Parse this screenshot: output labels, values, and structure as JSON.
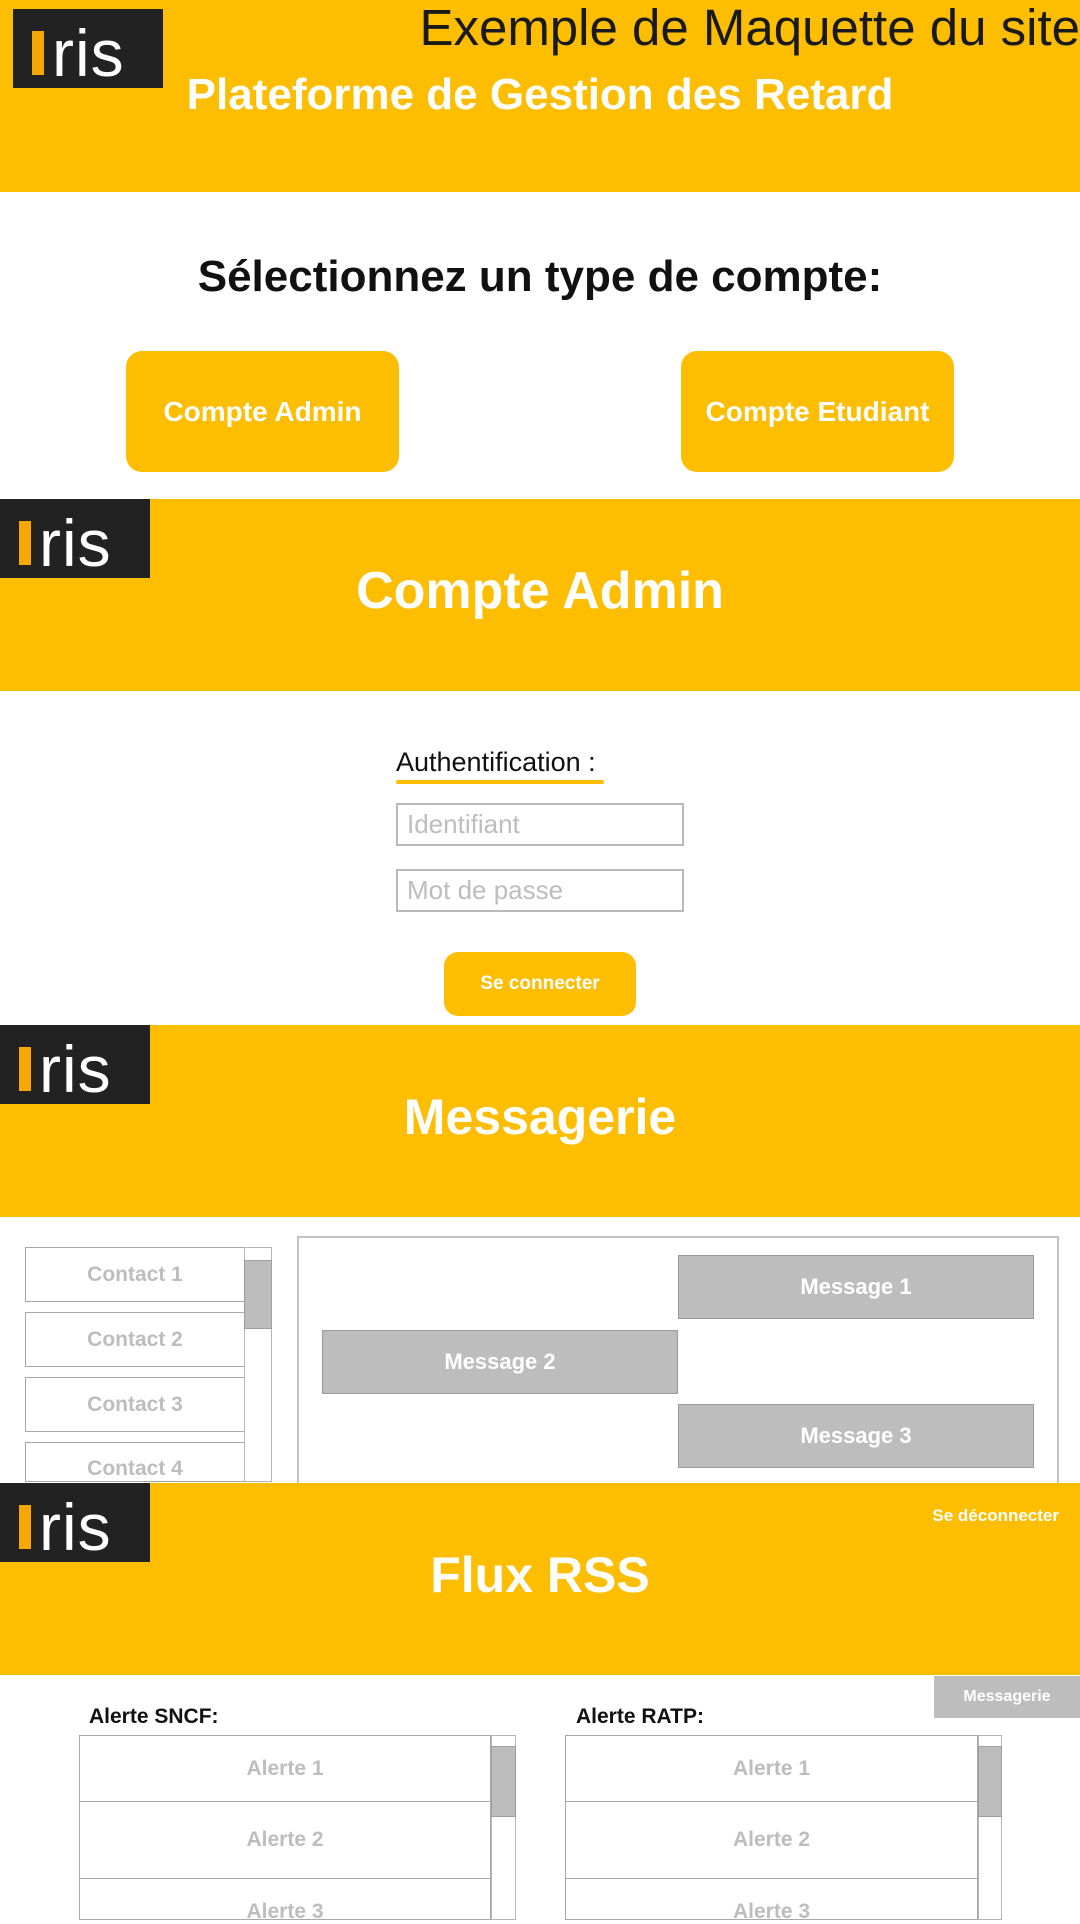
{
  "logo_text": "ris",
  "screen1": {
    "mockup_label": "Exemple de Maquette du site",
    "platform_title": "Plateforme de Gestion des Retard",
    "prompt": "Sélectionnez un type de compte:",
    "admin_button": "Compte Admin",
    "student_button": "Compte Etudiant"
  },
  "screen2": {
    "title": "Compte Admin",
    "auth_label": "Authentification :",
    "id_placeholder": "Identifiant",
    "password_placeholder": "Mot de passe",
    "login_button": "Se connecter"
  },
  "screen3": {
    "title": "Messagerie",
    "contacts": [
      "Contact 1",
      "Contact 2",
      "Contact 3",
      "Contact 4"
    ],
    "messages": [
      "Message 1",
      "Message 2",
      "Message 3"
    ]
  },
  "screen4": {
    "title": "Flux RSS",
    "logout_link": "Se déconnecter",
    "messagerie_button": "Messagerie",
    "sncf_label": "Alerte SNCF:",
    "ratp_label": "Alerte RATP:",
    "sncf_alerts": [
      "Alerte 1",
      "Alerte 2",
      "Alerte 3"
    ],
    "ratp_alerts": [
      "Alerte 1",
      "Alerte 2",
      "Alerte 3"
    ]
  },
  "colors": {
    "brand_yellow": "#FDBD01",
    "logo_dark": "#222222",
    "gray": "#BDBDBD"
  },
  "icons": [
    "iris-logo"
  ]
}
